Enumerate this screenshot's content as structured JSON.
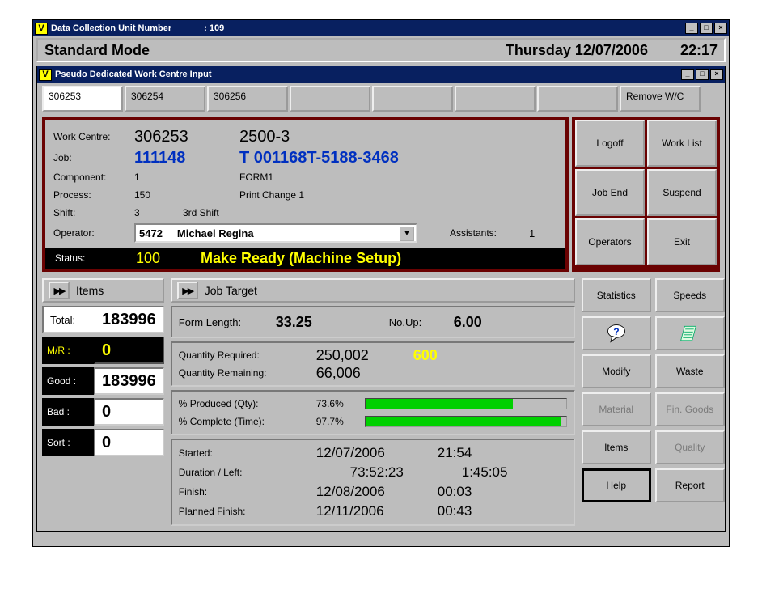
{
  "outer_title": {
    "label": "Data Collection Unit Number",
    "value": ": 109"
  },
  "mode": {
    "name": "Standard Mode",
    "date": "Thursday  12/07/2006",
    "time": "22:17"
  },
  "inner_title": "Pseudo Dedicated Work Centre Input",
  "tabs": [
    "306253",
    "306254",
    "306256",
    "",
    "",
    "",
    ""
  ],
  "remove_wc": "Remove W/C",
  "info": {
    "work_centre": {
      "label": "Work Centre:",
      "id": "306253",
      "name": "2500-3"
    },
    "job": {
      "label": "Job:",
      "id": "111148",
      "name": "T 001168T-5188-3468"
    },
    "component": {
      "label": "Component:",
      "id": "1",
      "name": "FORM1"
    },
    "process": {
      "label": "Process:",
      "id": "150",
      "name": "Print Change 1"
    },
    "shift": {
      "label": "Shift:",
      "id": "3",
      "name": "3rd Shift"
    },
    "operator": {
      "label": "Operator:",
      "id": "5472",
      "name": "Michael Regina",
      "assistants_label": "Assistants:",
      "assistants": "1"
    },
    "status": {
      "label": "Status:",
      "code": "100",
      "text": "Make Ready (Machine Setup)"
    }
  },
  "actions": [
    "Logoff",
    "Work List",
    "Job End",
    "Suspend",
    "Operators",
    "Exit"
  ],
  "items": {
    "header": "Items",
    "total_label": "Total:",
    "total": "183996",
    "mr_label": "M/R   :",
    "mr": "0",
    "good_label": "Good  :",
    "good": "183996",
    "bad_label": "Bad   :",
    "bad": "0",
    "sort_label": "Sort  :",
    "sort": "0"
  },
  "target": {
    "header": "Job Target",
    "form_length_label": "Form Length:",
    "form_length": "33.25",
    "no_up_label": "No.Up:",
    "no_up": "6.00",
    "qty_req_label": "Quantity Required:",
    "qty_req": "250,002",
    "qty_extra": "600",
    "qty_rem_label": "Quantity Remaining:",
    "qty_rem": "66,006",
    "pct_prod_label": "% Produced (Qty):",
    "pct_prod": "73.6%",
    "pct_prod_w": "73.6%",
    "pct_time_label": "% Complete (Time):",
    "pct_time": "97.7%",
    "pct_time_w": "97.7%",
    "started_label": "Started:",
    "started_d": "12/07/2006",
    "started_t": "21:54",
    "duration_label": "Duration / Left:",
    "duration_d": "73:52:23",
    "duration_t": "1:45:05",
    "finish_label": "Finish:",
    "finish_d": "12/08/2006",
    "finish_t": "00:03",
    "planned_label": "Planned Finish:",
    "planned_d": "12/11/2006",
    "planned_t": "00:43"
  },
  "rbuttons": {
    "statistics": "Statistics",
    "speeds": "Speeds",
    "modify": "Modify",
    "waste": "Waste",
    "material": "Material",
    "fingoods": "Fin. Goods",
    "items": "Items",
    "quality": "Quality",
    "help": "Help",
    "report": "Report"
  }
}
